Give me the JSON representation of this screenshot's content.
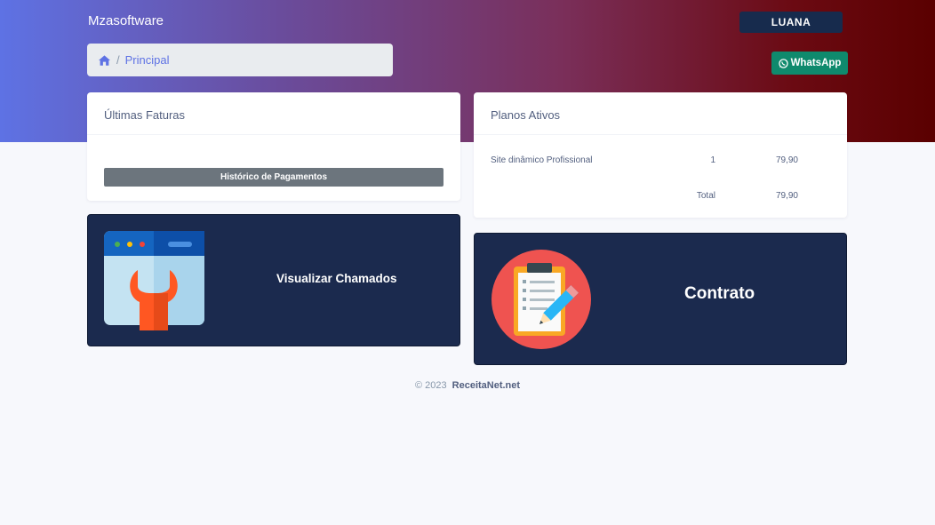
{
  "header": {
    "brand": "Mzasoftware",
    "user_label": "LUANA",
    "whatsapp_label": "WhatsApp"
  },
  "breadcrumb": {
    "separator": "/",
    "current": "Principal"
  },
  "faturas": {
    "title": "Últimas Faturas",
    "history_button": "Histórico de Pagamentos"
  },
  "planos": {
    "title": "Planos Ativos",
    "rows": [
      {
        "name": "Site dinâmico Profissional",
        "qty": "1",
        "price": "79,90"
      }
    ],
    "total_label": "Total",
    "total_value": "79,90"
  },
  "chamados": {
    "label": "Visualizar Chamados"
  },
  "contrato": {
    "label": "Contrato"
  },
  "footer": {
    "copyright": "© 2023",
    "company": "ReceitaNet.net"
  },
  "colors": {
    "primary": "#5e72e4",
    "dark_card": "#1b2a4e",
    "whatsapp": "#0f8a6d",
    "history_button": "#6c757d",
    "gradient_end": "#5a0000"
  },
  "icons": [
    "home-icon",
    "whatsapp-icon",
    "browser-wrench-icon",
    "clipboard-pencil-icon"
  ]
}
